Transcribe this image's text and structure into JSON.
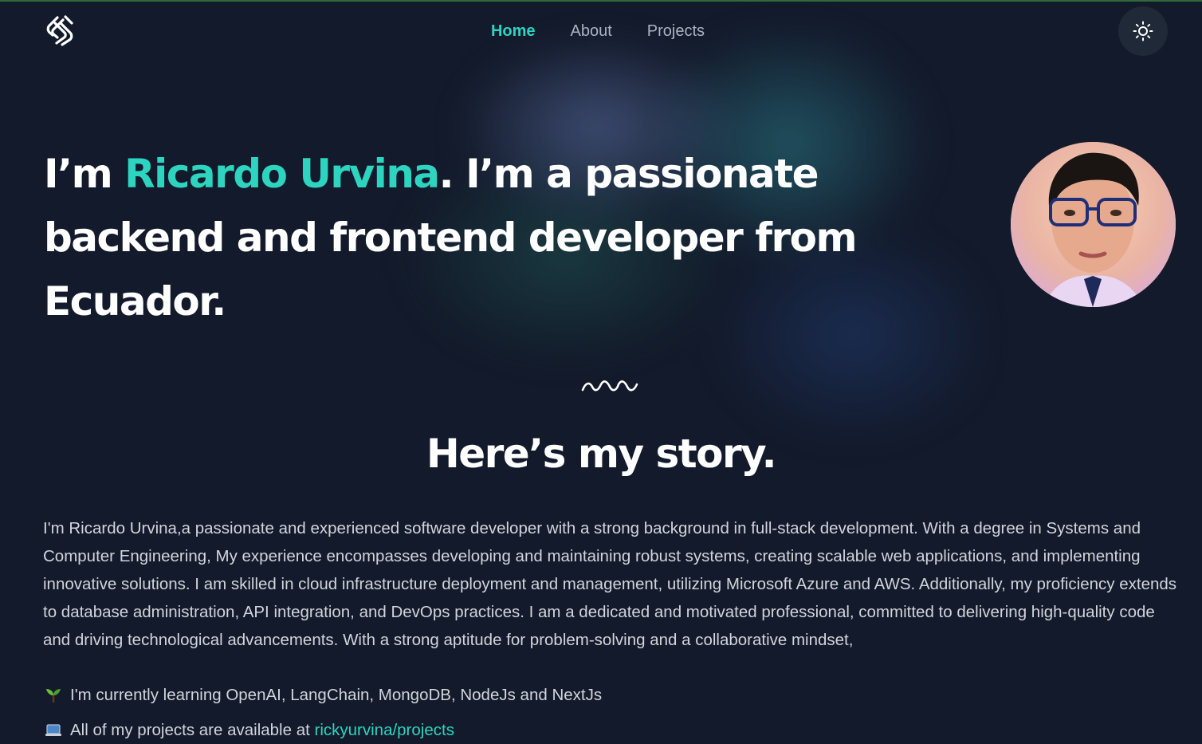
{
  "nav": {
    "items": [
      {
        "label": "Home",
        "active": true
      },
      {
        "label": "About",
        "active": false
      },
      {
        "label": "Projects",
        "active": false
      }
    ]
  },
  "theme_toggle": {
    "icon": "sun-icon"
  },
  "hero": {
    "intro": "I’m ",
    "name": "Ricardo Urvina",
    "rest": ". I’m a passionate backend and frontend developer from Ecuador."
  },
  "story": {
    "title": "Here’s my story.",
    "paragraph": "I'm Ricardo Urvina,a passionate and experienced software developer with a strong background in full-stack development. With a degree in Systems and Computer Engineering, My experience encompasses developing and maintaining robust systems, creating scalable web applications, and implementing innovative solutions. I am skilled in cloud infrastructure deployment and management, utilizing Microsoft Azure and AWS. Additionally, my proficiency extends to database administration, API integration, and DevOps practices. I am a dedicated and motivated professional, committed to delivering high-quality code and driving technological advancements. With a strong aptitude for problem-solving and a collaborative mindset,"
  },
  "facts": {
    "learning": {
      "icon": "seedling-icon",
      "text": "I'm currently learning OpenAI, LangChain, MongoDB, NodeJs and NextJs"
    },
    "projects": {
      "icon": "laptop-icon",
      "text": "All of my projects are available at ",
      "link_label": "rickyurvina/projects"
    }
  },
  "colors": {
    "accent": "#2dd4bf",
    "background": "#131a2b",
    "text": "#d1d5db"
  }
}
